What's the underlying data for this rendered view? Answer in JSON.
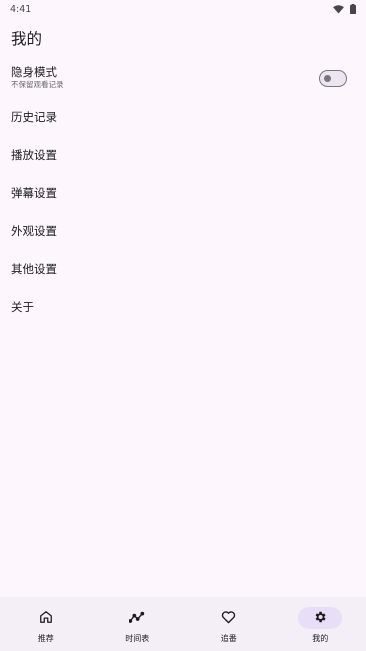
{
  "status_bar": {
    "time": "4:41"
  },
  "header": {
    "title": "我的"
  },
  "incognito": {
    "title": "隐身模式",
    "subtitle": "不保留观看记录",
    "enabled": false
  },
  "menu": [
    {
      "label": "历史记录"
    },
    {
      "label": "播放设置"
    },
    {
      "label": "弹幕设置"
    },
    {
      "label": "外观设置"
    },
    {
      "label": "其他设置"
    },
    {
      "label": "关于"
    }
  ],
  "bottom_nav": {
    "items": [
      {
        "label": "推荐",
        "icon": "home-icon",
        "active": false
      },
      {
        "label": "时间表",
        "icon": "timeline-icon",
        "active": false
      },
      {
        "label": "追番",
        "icon": "heart-icon",
        "active": false
      },
      {
        "label": "我的",
        "icon": "gear-icon",
        "active": true
      }
    ]
  },
  "colors": {
    "background": "#fdf7fd",
    "nav_background": "#f4eef6",
    "active_indicator": "#e8def8"
  }
}
